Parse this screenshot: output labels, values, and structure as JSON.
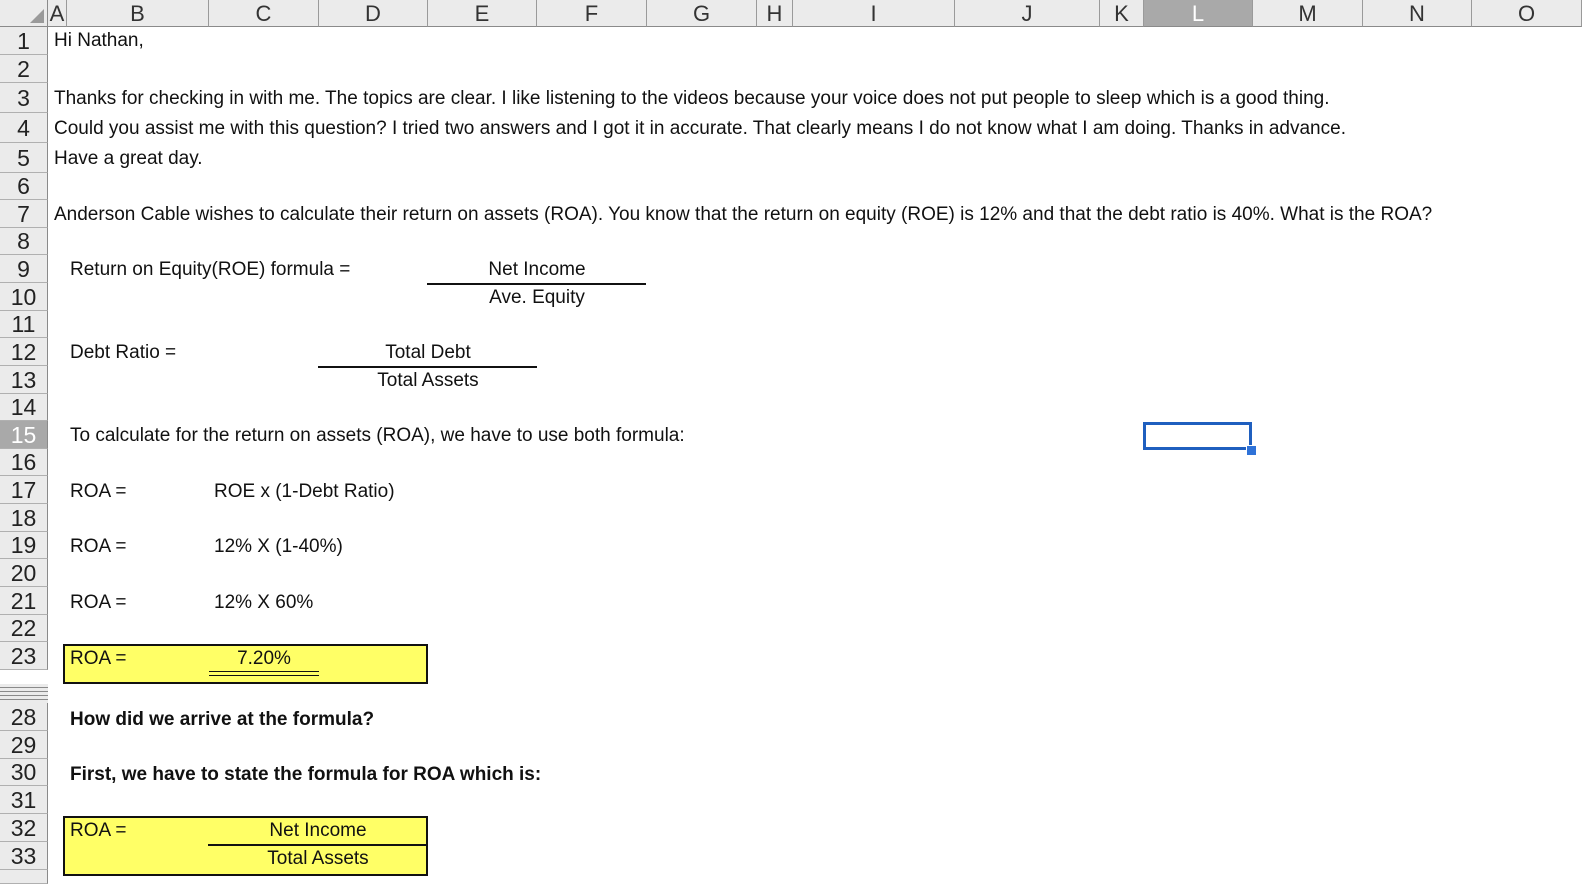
{
  "columns": [
    "A",
    "B",
    "C",
    "D",
    "E",
    "F",
    "G",
    "H",
    "I",
    "J",
    "K",
    "L",
    "M",
    "N",
    "O"
  ],
  "selected_column": "L",
  "rows": [
    "1",
    "2",
    "3",
    "4",
    "5",
    "6",
    "7",
    "8",
    "9",
    "10",
    "11",
    "12",
    "13",
    "14",
    "15",
    "16",
    "17",
    "18",
    "19",
    "20",
    "21",
    "22",
    "23",
    "28",
    "29",
    "30",
    "31",
    "32",
    "33"
  ],
  "selected_row": "15",
  "cells": {
    "r1": "Hi Nathan,",
    "r3": "Thanks for checking in with me.  The topics are clear.  I like listening to the videos because your voice does not put people to sleep which is a good thing.",
    "r4": "Could you assist me with this question?  I tried two answers and I got it in accurate. That clearly means I do not know what I am doing.  Thanks in advance.",
    "r5": "Have a great day.",
    "r7": "Anderson Cable wishes to calculate their return on assets (ROA). You know that the return on equity (ROE) is 12% and that the debt ratio is 40%. What is the ROA?",
    "roe_label": "Return on Equity(ROE) formula =",
    "roe_num": "Net Income",
    "roe_den": "Ave. Equity",
    "debt_label": "Debt Ratio =",
    "debt_num": "Total Debt",
    "debt_den": "Total Assets",
    "r15": "To calculate for the return on assets (ROA), we have to use both formula:",
    "roa_label": "ROA =",
    "r17_val": "ROE x (1-Debt Ratio)",
    "r19_val": "12% X (1-40%)",
    "r21_val": "12% X 60%",
    "r23_val": "7.20%",
    "r28": "How did we arrive at the formula?",
    "r30": "First, we have to state the formula for ROA which is:",
    "r32_num": "Net Income",
    "r33_den": "Total Assets"
  }
}
